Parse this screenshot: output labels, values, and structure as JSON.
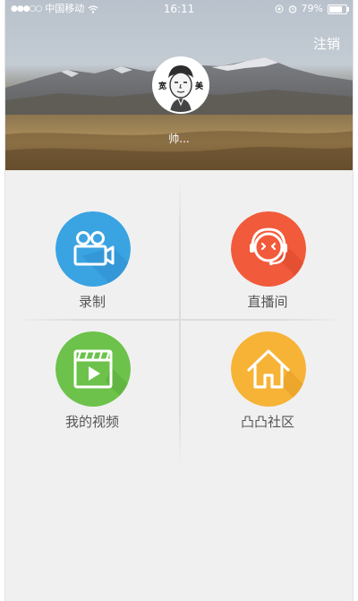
{
  "status_bar": {
    "carrier": "中国移动",
    "time": "16:11",
    "battery": "79%"
  },
  "header": {
    "logout_label": "注销",
    "avatar_left_text": "宽",
    "avatar_right_text": "美",
    "username": "帅..."
  },
  "menu": [
    {
      "label": "录制",
      "icon": "video-camera-icon",
      "color": "#3aa3e2"
    },
    {
      "label": "直播间",
      "icon": "headset-face-icon",
      "color": "#f15a3a"
    },
    {
      "label": "我的视频",
      "icon": "clapperboard-play-icon",
      "color": "#6cc24a"
    },
    {
      "label": "凸凸社区",
      "icon": "house-icon",
      "color": "#f6b336"
    }
  ]
}
